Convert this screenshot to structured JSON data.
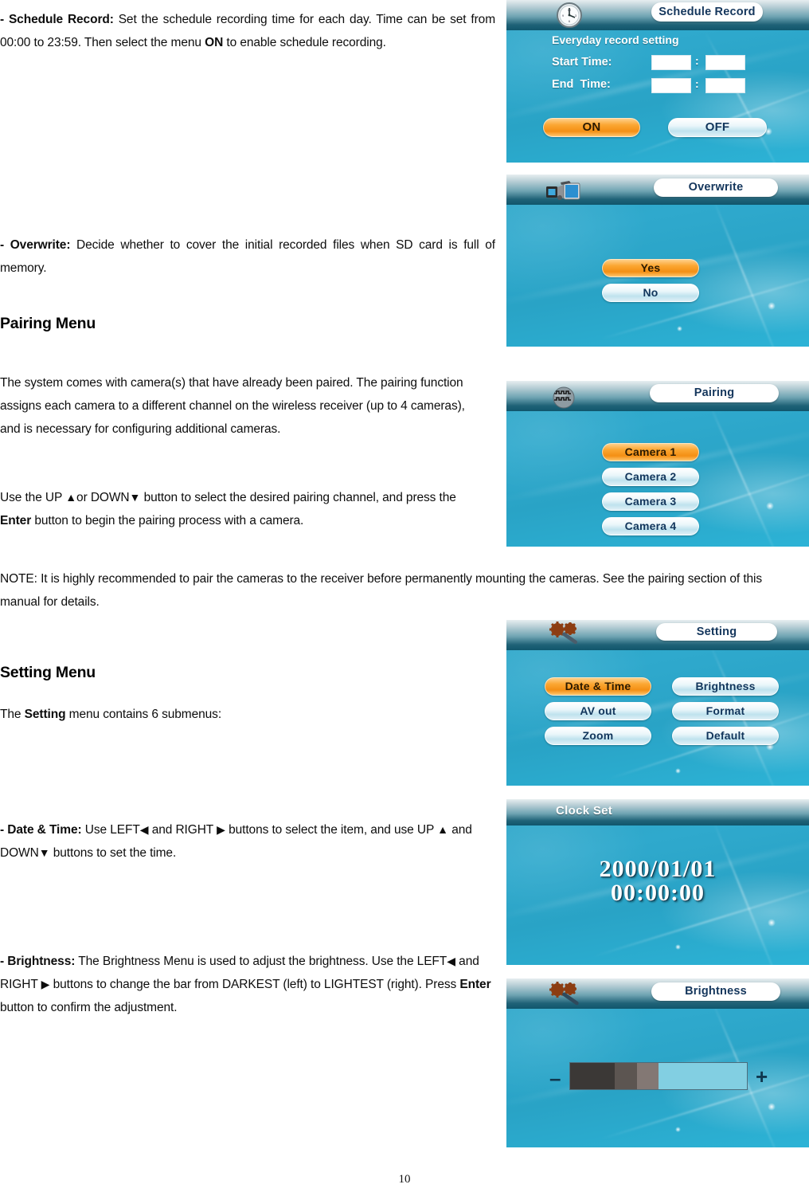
{
  "page": {
    "number": "10"
  },
  "body": {
    "schedule_record": {
      "lead": "- Schedule Record:",
      "text": " Set the schedule recording time for each day. Time can be set from 00:00 to 23:59. Then select the menu ",
      "bold_mid": "ON",
      "tail": " to enable schedule recording."
    },
    "overwrite": {
      "lead": "- Overwrite:",
      "text": " Decide whether to cover the initial recorded files when SD card is full of memory."
    },
    "pairing_heading": "Pairing Menu",
    "pairing_p1": "The system comes with camera(s) that have already been paired. The pairing function assigns each camera to a different channel on the wireless receiver (up to 4 cameras), and is necessary for configuring additional cameras.",
    "pairing_p2_a": "Use the UP ",
    "pairing_p2_up": "▲",
    "pairing_p2_b": "or DOWN",
    "pairing_p2_down": "▼",
    "pairing_p2_c": " button to select the desired pairing channel, and press the ",
    "pairing_p2_enter": "Enter",
    "pairing_p2_d": " button to begin the pairing process with a camera.",
    "note": "NOTE: It is highly recommended to pair the cameras to the receiver before permanently mounting the cameras. See the pairing section of this manual for details.",
    "setting_heading": "Setting Menu",
    "setting_p_a": "The ",
    "setting_p_bold": "Setting",
    "setting_p_b": " menu contains 6 submenus:",
    "datetime": {
      "lead": "- Date & Time:",
      "a": " Use LEFT",
      "left": "◀",
      "b": " and RIGHT ",
      "right": "▶",
      "c": " buttons to select the item, and use UP ",
      "up": "▲",
      "d": " and DOWN",
      "down": "▼",
      "e": " buttons to set the time."
    },
    "brightness": {
      "lead": "- Brightness:",
      "a": " The Brightness Menu is used to adjust the brightness. Use the LEFT",
      "left": "◀",
      "b": " and RIGHT ",
      "right": "▶",
      "c": " buttons to change the bar from DARKEST (left) to LIGHTEST (right). Press ",
      "enter": "Enter",
      "d": " button to confirm the adjustment."
    }
  },
  "panels": {
    "schedule_record": {
      "title": "Schedule Record",
      "icon": "clock-icon",
      "subtitle": "Everyday record setting",
      "rows": [
        {
          "label": "Start Time:",
          "hour": "",
          "separator": ":",
          "minute": ""
        },
        {
          "label": "End  Time:",
          "hour": "",
          "separator": ":",
          "minute": ""
        }
      ],
      "buttons": [
        {
          "label": "ON",
          "selected": true
        },
        {
          "label": "OFF",
          "selected": false
        }
      ]
    },
    "overwrite": {
      "title": "Overwrite",
      "icon": "camcorder-icon",
      "buttons": [
        {
          "label": "Yes",
          "selected": true
        },
        {
          "label": "No",
          "selected": false
        }
      ]
    },
    "pairing": {
      "title": "Pairing",
      "icon": "wireless-globe-icon",
      "buttons": [
        {
          "label": "Camera 1",
          "selected": true
        },
        {
          "label": "Camera 2",
          "selected": false
        },
        {
          "label": "Camera 3",
          "selected": false
        },
        {
          "label": "Camera 4",
          "selected": false
        }
      ]
    },
    "setting": {
      "title": "Setting",
      "icon": "gears-wrench-icon",
      "buttons": [
        {
          "label": "Date & Time",
          "selected": true
        },
        {
          "label": "Brightness",
          "selected": false
        },
        {
          "label": "AV out",
          "selected": false
        },
        {
          "label": "Format",
          "selected": false
        },
        {
          "label": "Zoom",
          "selected": false
        },
        {
          "label": "Default",
          "selected": false
        }
      ]
    },
    "clock_set": {
      "title": "Clock Set",
      "date": "2000/01/01",
      "time": "00:00:00"
    },
    "brightness": {
      "title": "Brightness",
      "icon": "gears-wrench-icon",
      "minus": "–",
      "plus": "+",
      "segments": [
        "#3b3836",
        "#5c5551",
        "#837874",
        "#82cfe2"
      ]
    }
  },
  "colors": {
    "osd_blue": "#2aa8cc",
    "accent_orange": "#f79321",
    "title_text": "#14365c",
    "header_dark": "#10566c"
  }
}
